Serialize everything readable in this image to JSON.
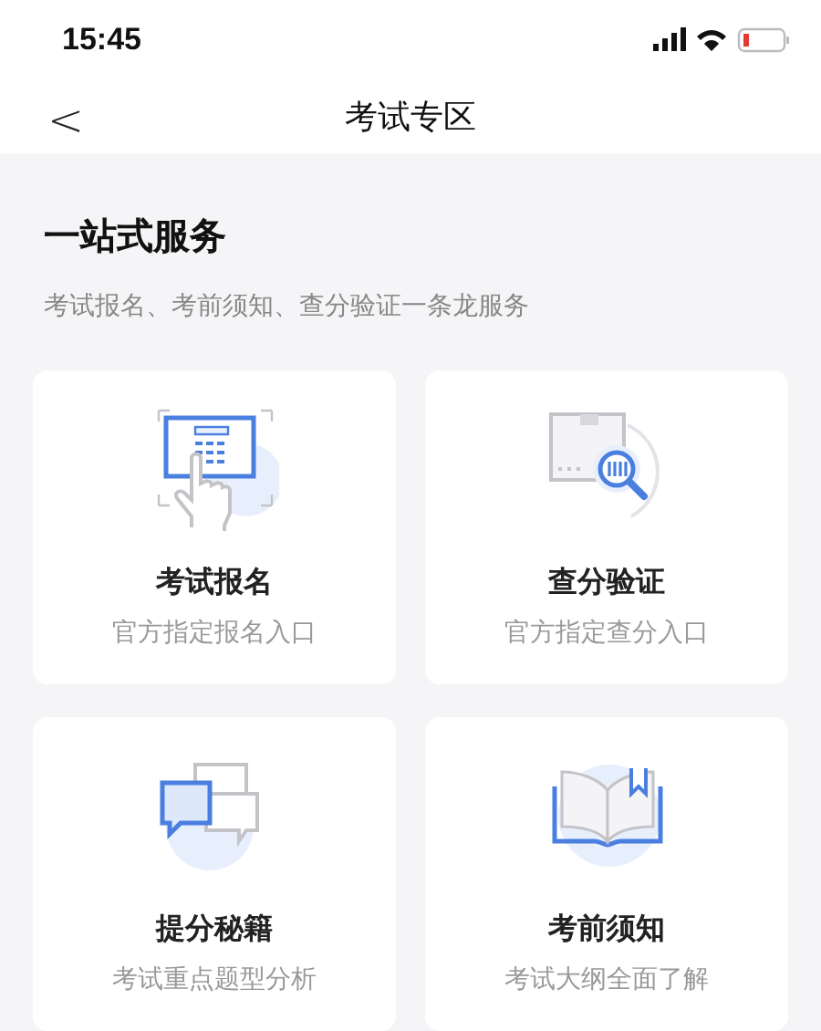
{
  "status_bar": {
    "time": "15:45"
  },
  "nav": {
    "back": "<",
    "title": "考试专区"
  },
  "section": {
    "title": "一站式服务",
    "subtitle": "考试报名、考前须知、查分验证一条龙服务"
  },
  "cards": [
    {
      "title": "考试报名",
      "subtitle": "官方指定报名入口"
    },
    {
      "title": "查分验证",
      "subtitle": "官方指定查分入口"
    },
    {
      "title": "提分秘籍",
      "subtitle": "考试重点题型分析"
    },
    {
      "title": "考前须知",
      "subtitle": "考试大纲全面了解"
    }
  ]
}
